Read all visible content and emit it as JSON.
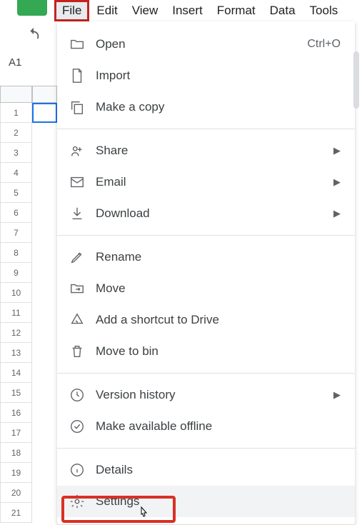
{
  "menubar": {
    "file": "File",
    "edit": "Edit",
    "view": "View",
    "insert": "Insert",
    "format": "Format",
    "data": "Data",
    "tools": "Tools"
  },
  "cell_reference": "A1",
  "rows": [
    "1",
    "2",
    "3",
    "4",
    "5",
    "6",
    "7",
    "8",
    "9",
    "10",
    "11",
    "12",
    "13",
    "14",
    "15",
    "16",
    "17",
    "18",
    "19",
    "20",
    "21"
  ],
  "menu": {
    "open": {
      "label": "Open",
      "shortcut": "Ctrl+O"
    },
    "import": {
      "label": "Import"
    },
    "make_copy": {
      "label": "Make a copy"
    },
    "share": {
      "label": "Share"
    },
    "email": {
      "label": "Email"
    },
    "download": {
      "label": "Download"
    },
    "rename": {
      "label": "Rename"
    },
    "move": {
      "label": "Move"
    },
    "add_shortcut": {
      "label": "Add a shortcut to Drive"
    },
    "move_bin": {
      "label": "Move to bin"
    },
    "version_history": {
      "label": "Version history"
    },
    "offline": {
      "label": "Make available offline"
    },
    "details": {
      "label": "Details"
    },
    "settings": {
      "label": "Settings"
    }
  }
}
